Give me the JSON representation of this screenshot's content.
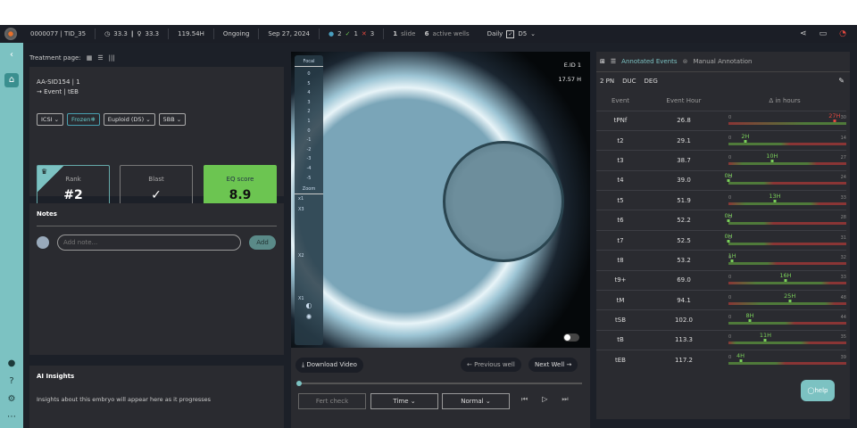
{
  "topbar": {
    "id": "0000077 | TID_35",
    "age1": "33.3",
    "age2": "33.3",
    "hours": "119.54H",
    "status": "Ongoing",
    "date": "Sep 27, 2024",
    "count_blue": "2",
    "count_check": "1",
    "count_x": "3",
    "slide_n": "1",
    "slide_label": "slide",
    "wells_n": "6",
    "wells_label": "active wells",
    "daily": "Daily",
    "day": "D5"
  },
  "left": {
    "treatment_label": "Treatment page:",
    "embryo_id": "AA-SID154 | 1",
    "event": "→ Event | tEB",
    "chips": [
      "ICSI",
      "Frozen",
      "Euploid (D5)",
      "5BB"
    ],
    "rank_label": "Rank",
    "rank_value": "#2",
    "blast_label": "Blast",
    "blast_value": "✓",
    "eq_label": "EQ score",
    "eq_value": "8.9",
    "notes_title": "Notes",
    "note_placeholder": "Add note...",
    "add_label": "Add",
    "ai_title": "AI Insights",
    "ai_text": "Insights about this embryo will appear here as it progresses"
  },
  "viewer": {
    "eid": "E.ID 1",
    "time": "17.57 H",
    "focal_label": "Focal",
    "focal_ticks": [
      "0",
      "5",
      "4",
      "3",
      "2",
      "1",
      "0",
      "-1",
      "-2",
      "-3",
      "-4",
      "-5"
    ],
    "zoom_label": "Zoom",
    "zoom_ticks": [
      "x1",
      "X3",
      "X2",
      "X1"
    ],
    "download": "Download Video",
    "prev": "← Previous well",
    "next": "Next Well →",
    "fert": "Fert check",
    "time_sel": "Time",
    "speed_sel": "Normal",
    "progress": 0.0
  },
  "right": {
    "tab1": "Annotated Events",
    "tab2": "Manual Annotation",
    "tags": [
      "2 PN",
      "DUC",
      "DEG"
    ],
    "headers": [
      "Event",
      "Event Hour",
      "Δ in hours"
    ],
    "rows": [
      {
        "event": "tPNf",
        "hour": "26.8",
        "delta": "27H",
        "d": 27,
        "max": "30",
        "bad": true
      },
      {
        "event": "t2",
        "hour": "29.1",
        "delta": "2H",
        "d": 2,
        "max": "14"
      },
      {
        "event": "t3",
        "hour": "38.7",
        "delta": "10H",
        "d": 10,
        "max": "27"
      },
      {
        "event": "t4",
        "hour": "39.0",
        "delta": "0H",
        "d": 0,
        "max": "24"
      },
      {
        "event": "t5",
        "hour": "51.9",
        "delta": "13H",
        "d": 13,
        "max": "33"
      },
      {
        "event": "t6",
        "hour": "52.2",
        "delta": "0H",
        "d": 0,
        "max": "28"
      },
      {
        "event": "t7",
        "hour": "52.5",
        "delta": "0H",
        "d": 0,
        "max": "31"
      },
      {
        "event": "t8",
        "hour": "53.2",
        "delta": "1H",
        "d": 1,
        "max": "32"
      },
      {
        "event": "t9+",
        "hour": "69.0",
        "delta": "16H",
        "d": 16,
        "max": "33"
      },
      {
        "event": "tM",
        "hour": "94.1",
        "delta": "25H",
        "d": 25,
        "max": "48"
      },
      {
        "event": "tSB",
        "hour": "102.0",
        "delta": "8H",
        "d": 8,
        "max": "44"
      },
      {
        "event": "tB",
        "hour": "113.3",
        "delta": "11H",
        "d": 11,
        "max": "35"
      },
      {
        "event": "tEB",
        "hour": "117.2",
        "delta": "4H",
        "d": 4,
        "max": "39"
      }
    ],
    "help": "help"
  },
  "colors": {
    "accent": "#7cc2c2",
    "eq": "#6cc551",
    "green": "#4f7a3a",
    "red": "#8a3535",
    "label_green": "#7bd15a",
    "label_red": "#e5483f"
  }
}
